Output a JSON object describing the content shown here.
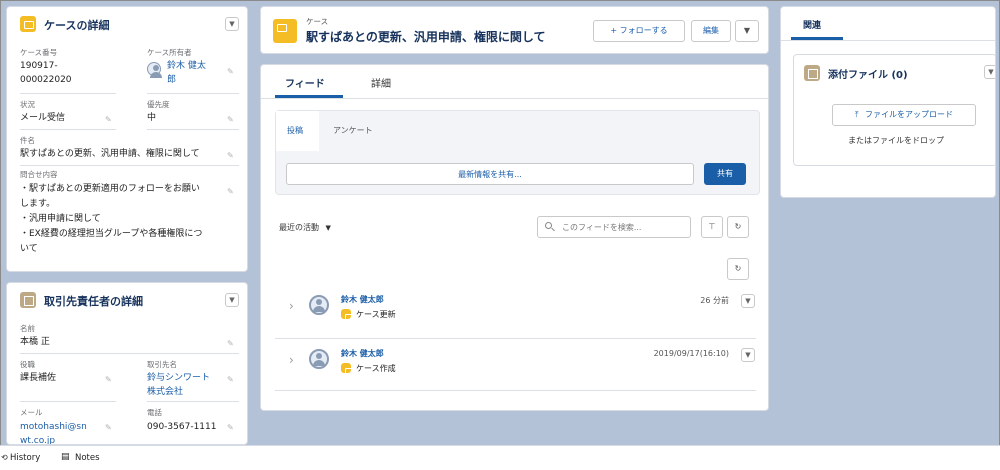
{
  "case_detail": {
    "title": "ケースの詳細",
    "case_number_label": "ケース番号",
    "case_number_line1": "190917-",
    "case_number_line2": "000022020",
    "owner_label": "ケース所有者",
    "owner_line1": "鈴木 健太",
    "owner_line2": "郎",
    "status_label": "状況",
    "status_value": "メール受信",
    "priority_label": "優先度",
    "priority_value": "中",
    "subject_label": "件名",
    "subject_value": "駅すぱあとの更新、汎用申請、権限に関して",
    "inquiry_label": "問合せ内容",
    "inquiry_lines": [
      "・駅すぱあとの更新適用のフォローをお願い",
      "します。",
      "・汎用申請に関して",
      "・EX経費の経理担当グループや各種権限につ",
      "いて"
    ]
  },
  "contact_detail": {
    "title": "取引先責任者の詳細",
    "name_label": "名前",
    "name_value": "本橋 正",
    "position_label": "役職",
    "position_value": "課長補佐",
    "account_label": "取引先名",
    "account_line1": "鈴与シンワート",
    "account_line2": "株式会社",
    "email_label": "メール",
    "email_line1": "motohashi@sn",
    "email_line2": "wt.co.jp",
    "phone_label": "電話",
    "phone_value": "090-3567-1111"
  },
  "header": {
    "object_label": "ケース",
    "title": "駅すぱあとの更新、汎用申請、権限に関して",
    "follow_button": "+ フォローする",
    "edit_button": "編集"
  },
  "feed": {
    "tabs": [
      "フィード",
      "詳細"
    ],
    "subtabs": [
      "投稿",
      "アンケート"
    ],
    "share_placeholder": "最新情報を共有...",
    "share_button": "共有",
    "sort_label": "最近の活動",
    "search_placeholder": "このフィードを検索...",
    "items": [
      {
        "author": "鈴木 健太郎",
        "action": "ケース更新",
        "time": "26 分前"
      },
      {
        "author": "鈴木 健太郎",
        "action": "ケース作成",
        "time": "2019/09/17(16:10)"
      }
    ]
  },
  "related": {
    "tab": "関連",
    "attachments_title": "添付ファイル (0)",
    "upload_button": "ファイルをアップロード",
    "drop_text": "またはファイルをドロップ"
  },
  "utility_bar": {
    "history": "History",
    "notes": "Notes"
  },
  "colors": {
    "background": "#b4c2d8",
    "brand_blue": "#1b5ea8",
    "case_icon": "#f4bc25"
  }
}
